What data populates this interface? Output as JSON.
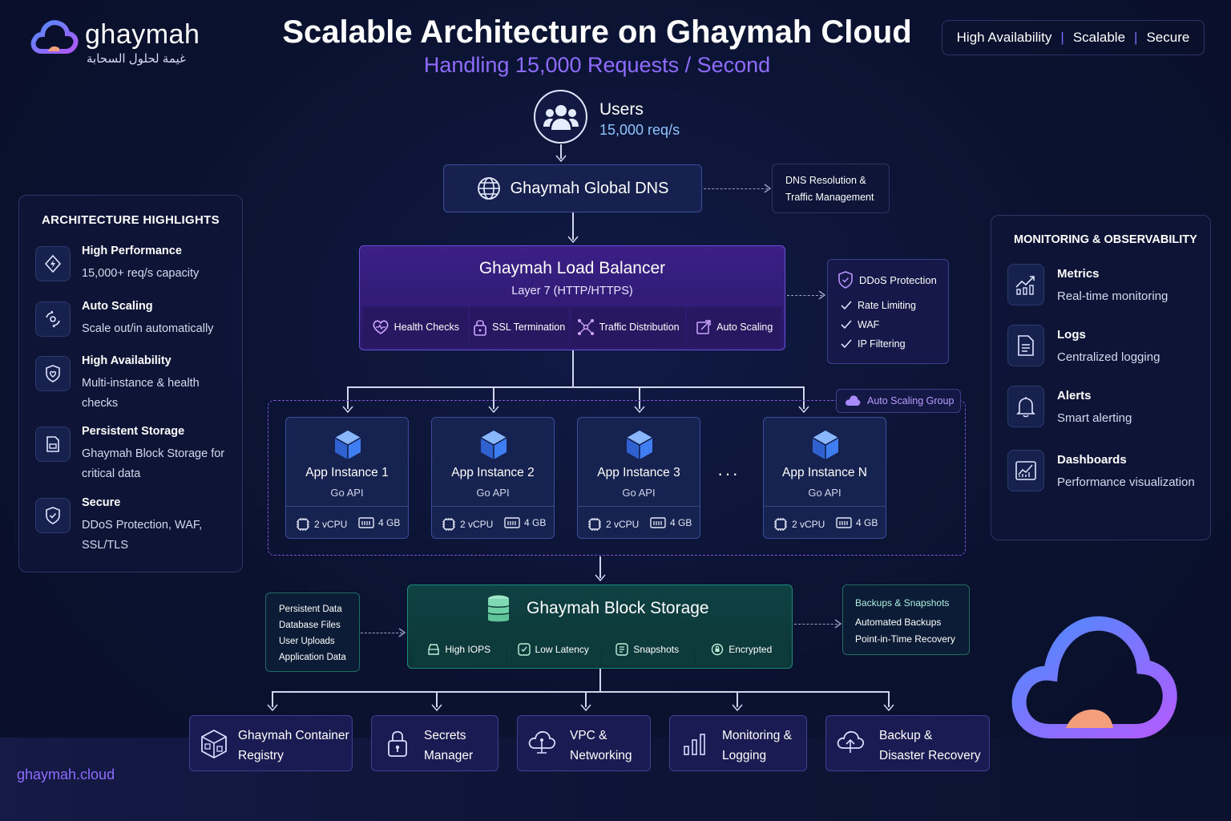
{
  "brand": {
    "name": "ghaymah",
    "arabic_tagline": "غيمة لحلول السحابة",
    "domain": "ghaymah.cloud"
  },
  "header": {
    "title": "Scalable Architecture on Ghaymah Cloud",
    "subtitle": "Handling 15,000 Requests / Second",
    "tags": [
      "High Availability",
      "Scalable",
      "Secure"
    ]
  },
  "highlights": {
    "title": "ARCHITECTURE HIGHLIGHTS",
    "items": [
      {
        "title": "High Performance",
        "desc": "15,000+ req/s capacity",
        "icon": "performance-icon"
      },
      {
        "title": "Auto Scaling",
        "desc": "Scale out/in automatically",
        "icon": "scaling-icon"
      },
      {
        "title": "High Availability",
        "desc": "Multi-instance & health checks",
        "icon": "availability-icon"
      },
      {
        "title": "Persistent Storage",
        "desc": "Ghaymah Block Storage for critical data",
        "icon": "storage-icon"
      },
      {
        "title": "Secure",
        "desc": "DDoS Protection, WAF, SSL/TLS",
        "icon": "secure-icon"
      }
    ]
  },
  "users": {
    "title": "Users",
    "rate": "15,000 req/s"
  },
  "dns": {
    "label": "Ghaymah Global DNS",
    "note": "DNS Resolution & Traffic Management"
  },
  "load_balancer": {
    "title": "Ghaymah Load Balancer",
    "layer": "Layer 7 (HTTP/HTTPS)",
    "features": [
      "Health Checks",
      "SSL Termination",
      "Traffic Distribution",
      "Auto Scaling"
    ]
  },
  "ddos": {
    "title": "DDoS Protection",
    "items": [
      "Rate Limiting",
      "WAF",
      "IP Filtering"
    ]
  },
  "asg": {
    "label": "Auto Scaling Group",
    "ellipsis": "···",
    "instances": [
      {
        "name": "App Instance 1",
        "stack": "Go API",
        "cpu": "2 vCPU",
        "mem": "4 GB"
      },
      {
        "name": "App Instance 2",
        "stack": "Go API",
        "cpu": "2 vCPU",
        "mem": "4 GB"
      },
      {
        "name": "App Instance 3",
        "stack": "Go API",
        "cpu": "2 vCPU",
        "mem": "4 GB"
      },
      {
        "name": "App Instance N",
        "stack": "Go API",
        "cpu": "2 vCPU",
        "mem": "4 GB"
      }
    ]
  },
  "block_storage": {
    "title": "Ghaymah Block Storage",
    "features": [
      "High IOPS",
      "Low Latency",
      "Snapshots",
      "Encrypted"
    ]
  },
  "persistent_data": {
    "items": [
      "Persistent Data",
      "Database Files",
      "User Uploads",
      "Application Data"
    ]
  },
  "backups": {
    "title": "Backups & Snapshots",
    "items": [
      "Automated Backups",
      "Point-in-Time Recovery"
    ]
  },
  "services": [
    {
      "line1": "Ghaymah Container",
      "line2": "Registry",
      "icon": "container-registry-icon"
    },
    {
      "line1": "Secrets",
      "line2": "Manager",
      "icon": "lock-icon"
    },
    {
      "line1": "VPC &",
      "line2": "Networking",
      "icon": "cloud-network-icon"
    },
    {
      "line1": "Monitoring &",
      "line2": "Logging",
      "icon": "bar-chart-icon"
    },
    {
      "line1": "Backup &",
      "line2": "Disaster Recovery",
      "icon": "cloud-backup-icon"
    }
  ],
  "monitoring": {
    "title": "MONITORING & OBSERVABILITY",
    "items": [
      {
        "title": "Metrics",
        "desc": "Real-time monitoring",
        "icon": "metrics-icon"
      },
      {
        "title": "Logs",
        "desc": "Centralized logging",
        "icon": "logs-icon"
      },
      {
        "title": "Alerts",
        "desc": "Smart alerting",
        "icon": "bell-icon"
      },
      {
        "title": "Dashboards",
        "desc": "Performance visualization",
        "icon": "dashboard-icon"
      }
    ]
  },
  "colors": {
    "accent_purple": "#8f6bff",
    "storage_green": "#0f3b3a",
    "lb_purple": "#3a1f7a"
  }
}
